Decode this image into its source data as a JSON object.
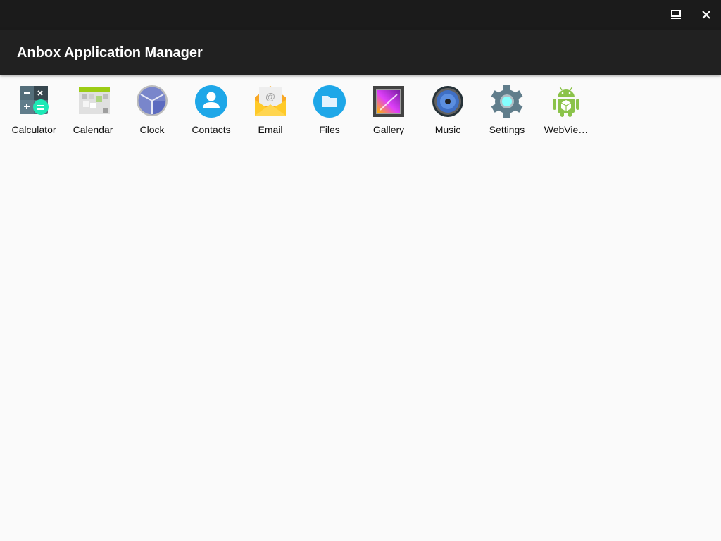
{
  "window": {
    "controls": [
      {
        "name": "restore",
        "icon": "restore-window-icon"
      },
      {
        "name": "close",
        "icon": "close-icon"
      }
    ]
  },
  "appbar": {
    "title": "Anbox Application Manager"
  },
  "apps": [
    {
      "label": "Calculator",
      "icon": "calculator-icon"
    },
    {
      "label": "Calendar",
      "icon": "calendar-icon"
    },
    {
      "label": "Clock",
      "icon": "clock-icon"
    },
    {
      "label": "Contacts",
      "icon": "contacts-icon"
    },
    {
      "label": "Email",
      "icon": "email-icon"
    },
    {
      "label": "Files",
      "icon": "files-icon"
    },
    {
      "label": "Gallery",
      "icon": "gallery-icon"
    },
    {
      "label": "Music",
      "icon": "music-icon"
    },
    {
      "label": "Settings",
      "icon": "settings-icon"
    },
    {
      "label": "WebVie…",
      "icon": "webview-android-icon"
    }
  ],
  "colors": {
    "titlebar": "#1b1b1b",
    "appbar": "#212121",
    "background": "#fafafa"
  }
}
